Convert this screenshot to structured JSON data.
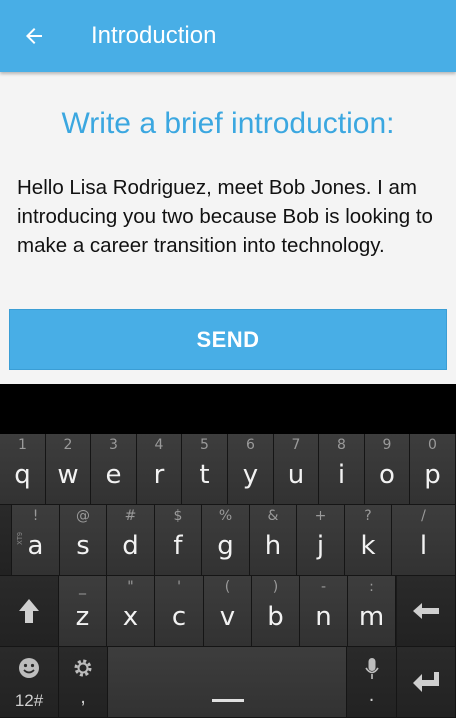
{
  "appbar": {
    "title": "Introduction",
    "back_icon": "arrow-left-icon",
    "color": "#48aee6"
  },
  "content": {
    "heading": "Write a brief introduction:",
    "message": "Hello Lisa Rodriguez, meet Bob Jones. I am introducing you two because Bob is looking to make a career transition into technology.",
    "send_label": "SEND"
  },
  "keyboard": {
    "row1": [
      {
        "k": "q",
        "h": "1"
      },
      {
        "k": "w",
        "h": "2"
      },
      {
        "k": "e",
        "h": "3"
      },
      {
        "k": "r",
        "h": "4"
      },
      {
        "k": "t",
        "h": "5"
      },
      {
        "k": "y",
        "h": "6"
      },
      {
        "k": "u",
        "h": "7"
      },
      {
        "k": "i",
        "h": "8"
      },
      {
        "k": "o",
        "h": "9"
      },
      {
        "k": "p",
        "h": "0"
      }
    ],
    "row2": [
      {
        "k": "a",
        "h": "!"
      },
      {
        "k": "s",
        "h": "@"
      },
      {
        "k": "d",
        "h": "#"
      },
      {
        "k": "f",
        "h": "$"
      },
      {
        "k": "g",
        "h": "%"
      },
      {
        "k": "h",
        "h": "&"
      },
      {
        "k": "j",
        "h": "+"
      },
      {
        "k": "k",
        "h": "?"
      },
      {
        "k": "l",
        "h": "/"
      }
    ],
    "row3": [
      {
        "k": "z",
        "h": "_"
      },
      {
        "k": "x",
        "h": "\""
      },
      {
        "k": "c",
        "h": "'"
      },
      {
        "k": "v",
        "h": "("
      },
      {
        "k": "b",
        "h": ")"
      },
      {
        "k": "n",
        "h": "-"
      },
      {
        "k": "m",
        "h": ":"
      }
    ],
    "xt9_label": "XT9",
    "symbols_label": "12#",
    "comma_label": ",",
    "period_label": "."
  }
}
